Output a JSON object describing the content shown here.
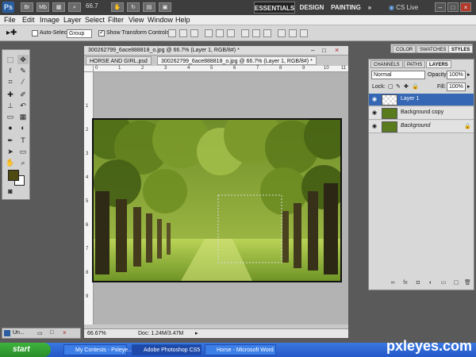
{
  "app": {
    "logo": "Ps",
    "zoom": "66.7",
    "workspaces": [
      "ESSENTIALS",
      "DESIGN",
      "PAINTING"
    ],
    "more": "»",
    "cs_live": "CS Live",
    "win_min": "–",
    "win_max": "□",
    "win_close": "×"
  },
  "menu": [
    "File",
    "Edit",
    "Image",
    "Layer",
    "Select",
    "Filter",
    "View",
    "Window",
    "Help"
  ],
  "options": {
    "auto_select_label": "Auto-Select:",
    "auto_select_value": "Group",
    "show_transform": "Show Transform Controls"
  },
  "document": {
    "tabs": [
      "HORSE AND GIRL.psd",
      "300262799_6ace888818_o.jpg @ 66.7% (Layer 1, RGB/8#) *"
    ],
    "title": "300262799_6ace888818_o.jpg @ 66.7% (Layer 1, RGB/8#) *",
    "ruler_ticks": [
      "0",
      "1",
      "2",
      "3",
      "4",
      "5",
      "6",
      "7",
      "8",
      "9",
      "10",
      "11"
    ],
    "zoom_status": "66.67%",
    "doc_status": "Doc: 1.24M/3.47M"
  },
  "panels": {
    "top_tabs": [
      "COLOR",
      "SWATCHES",
      "STYLES"
    ],
    "layer_tabs": [
      "CHANNELS",
      "PATHS",
      "LAYERS"
    ],
    "blend_mode": "Normal",
    "opacity_label": "Opacity:",
    "opacity_value": "100%",
    "lock_label": "Lock:",
    "fill_label": "Fill:",
    "fill_value": "100%",
    "layers": [
      {
        "name": "Layer 1",
        "selected": true
      },
      {
        "name": "Background copy",
        "selected": false
      },
      {
        "name": "Background",
        "selected": false,
        "locked": true
      }
    ]
  },
  "mini_panel": {
    "label": "Un..."
  },
  "taskbar": {
    "start": "start",
    "tasks": [
      "My Contests - Pxleye...",
      "Adobe Photoshop CS5",
      "Horse - Microsoft Word"
    ],
    "watermark": "pxleyes.com"
  },
  "colors": {
    "foreground": "#4f4a10",
    "background": "#ffffff",
    "selection": "#3567b4"
  }
}
